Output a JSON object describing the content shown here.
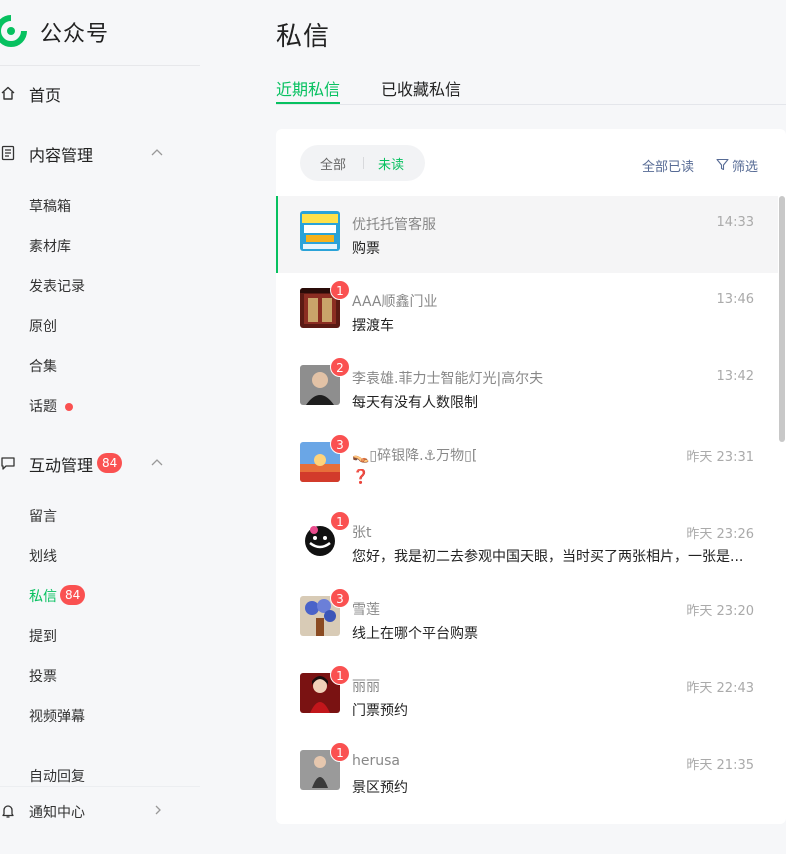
{
  "app": {
    "title": "公众号"
  },
  "sidebar": {
    "home": {
      "label": "首页"
    },
    "content_mgmt": {
      "label": "内容管理",
      "items": [
        {
          "label": "草稿箱"
        },
        {
          "label": "素材库"
        },
        {
          "label": "发表记录"
        },
        {
          "label": "原创"
        },
        {
          "label": "合集"
        },
        {
          "label": "话题"
        }
      ]
    },
    "interaction_mgmt": {
      "label": "互动管理",
      "badge": "84",
      "items": [
        {
          "label": "留言"
        },
        {
          "label": "划线"
        },
        {
          "label": "私信",
          "badge": "84"
        },
        {
          "label": "提到"
        },
        {
          "label": "投票"
        },
        {
          "label": "视频弹幕"
        },
        {
          "label": "自动回复"
        }
      ]
    },
    "notifications": {
      "label": "通知中心"
    }
  },
  "main": {
    "title": "私信",
    "tabs": [
      {
        "label": "近期私信"
      },
      {
        "label": "已收藏私信"
      }
    ],
    "filter": {
      "all": "全部",
      "unread": "未读"
    },
    "mark_all_read": "全部已读",
    "filter_button": "筛选",
    "messages": [
      {
        "name": "优托托管客服",
        "time": "14:33",
        "text": "购票",
        "unread": ""
      },
      {
        "name": "AAA顺鑫门业",
        "time": "13:46",
        "text": "摆渡车",
        "unread": "1"
      },
      {
        "name": "李袁雄.菲力士智能灯光|高尔夫",
        "time": "13:42",
        "text": "每天有没有人数限制",
        "unread": "2"
      },
      {
        "name": "👡▯碎银降.⚓万物▯[",
        "time": "昨天 23:31",
        "text": "❓",
        "unread": "3"
      },
      {
        "name": "张t",
        "time": "昨天 23:26",
        "text": "您好，我是初二去参观中国天眼，当时买了两张相片，一张是...",
        "unread": "1"
      },
      {
        "name": "雪莲",
        "time": "昨天 23:20",
        "text": "线上在哪个平台购票",
        "unread": "3"
      },
      {
        "name": "丽丽",
        "time": "昨天 22:43",
        "text": "门票预约",
        "unread": "1"
      },
      {
        "name": "herusa",
        "time": "昨天 21:35",
        "text": "景区预约",
        "unread": "1"
      }
    ]
  },
  "colors": {
    "accent": "#07c160",
    "badge": "#fa5151",
    "link": "#576b95"
  }
}
